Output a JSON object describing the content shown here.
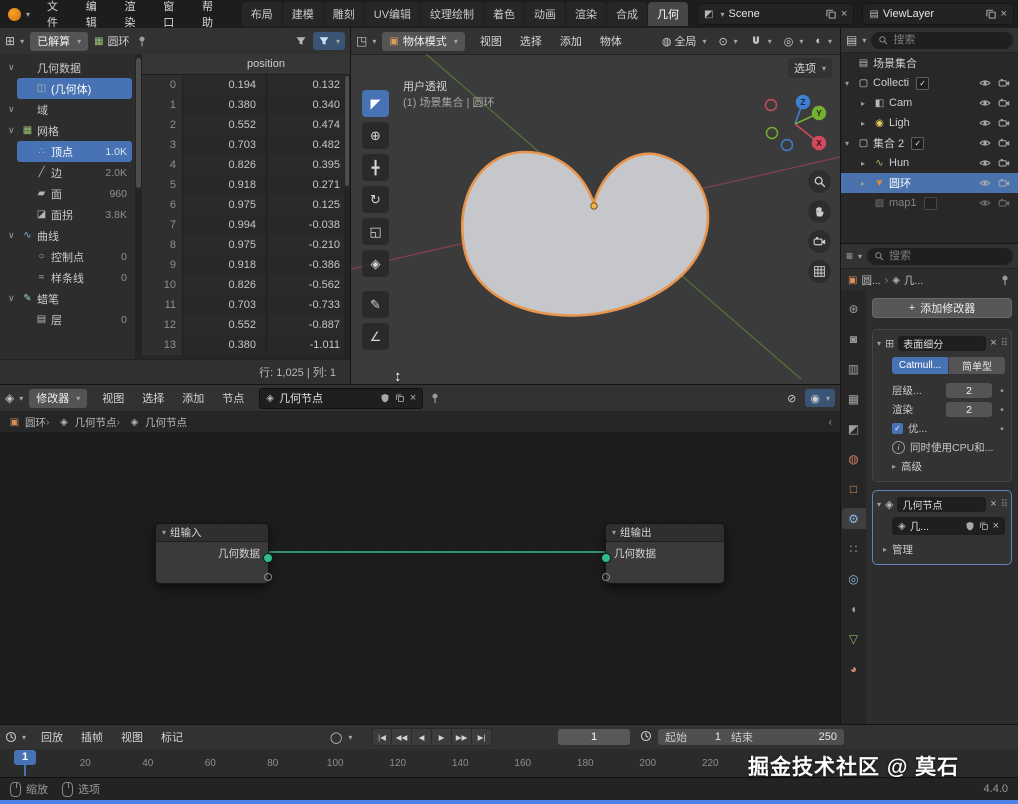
{
  "app": {
    "version": "4.4.0",
    "watermark": "掘金技术社区 @ 莫石"
  },
  "colors": {
    "accent": "#4772b3",
    "selection": "#4a72ad",
    "socket_green": "#2fbc8f",
    "curve_outline": "#e8964f",
    "axis_x": "#9c4352",
    "axis_y": "#5c8637",
    "axis_z": "#3f7fd2"
  },
  "icons": {
    "dropdown": "▾",
    "chevron_right": "▸",
    "chevron_down": "∨",
    "close": "×",
    "drag_dots": "⠿",
    "plus": "+",
    "info": "i",
    "back_arrow": "‹",
    "resize_vertical": "↕",
    "checkmark": "✓"
  },
  "topbar": {
    "menus": [
      "文件",
      "编辑",
      "渲染",
      "窗口",
      "帮助"
    ],
    "workspaces": [
      {
        "label": "布局"
      },
      {
        "label": "建模"
      },
      {
        "label": "雕刻"
      },
      {
        "label": "UV编辑"
      },
      {
        "label": "纹理绘制"
      },
      {
        "label": "着色"
      },
      {
        "label": "动画"
      },
      {
        "label": "渲染"
      },
      {
        "label": "合成"
      },
      {
        "label": "几何",
        "active": true
      }
    ],
    "scene": "Scene",
    "view_layer": "ViewLayer"
  },
  "spreadsheet": {
    "mode": "已解算",
    "object": "圆环",
    "tree": [
      {
        "label": "几何数据",
        "kind": "section"
      },
      {
        "label": "(几何体)",
        "kind": "item",
        "icon": "geometry",
        "selected": true
      },
      {
        "label": "域",
        "kind": "section"
      },
      {
        "label": "网格",
        "kind": "section",
        "icon": "mesh"
      },
      {
        "label": "顶点",
        "kind": "item",
        "icon": "vertex",
        "count": "1.0K",
        "selected": true
      },
      {
        "label": "边",
        "kind": "item",
        "icon": "edge",
        "count": "2.0K"
      },
      {
        "label": "面",
        "kind": "item",
        "icon": "face",
        "count": "960"
      },
      {
        "label": "面拐",
        "kind": "item",
        "icon": "corner",
        "count": "3.8K"
      },
      {
        "label": "曲线",
        "kind": "section",
        "icon": "curve"
      },
      {
        "label": "控制点",
        "kind": "item",
        "icon": "point",
        "count": "0"
      },
      {
        "label": "样条线",
        "kind": "item",
        "icon": "spline",
        "count": "0"
      },
      {
        "label": "蜡笔",
        "kind": "section",
        "icon": "pencil"
      },
      {
        "label": "层",
        "kind": "item",
        "icon": "layer",
        "count": "0"
      }
    ],
    "column": "position",
    "rows": [
      {
        "i": "0",
        "x": "0.194",
        "y": "0.132"
      },
      {
        "i": "1",
        "x": "0.380",
        "y": "0.340"
      },
      {
        "i": "2",
        "x": "0.552",
        "y": "0.474"
      },
      {
        "i": "3",
        "x": "0.703",
        "y": "0.482"
      },
      {
        "i": "4",
        "x": "0.826",
        "y": "0.395"
      },
      {
        "i": "5",
        "x": "0.918",
        "y": "0.271"
      },
      {
        "i": "6",
        "x": "0.975",
        "y": "0.125"
      },
      {
        "i": "7",
        "x": "0.994",
        "y": "-0.038"
      },
      {
        "i": "8",
        "x": "0.975",
        "y": "-0.210"
      },
      {
        "i": "9",
        "x": "0.918",
        "y": "-0.386"
      },
      {
        "i": "10",
        "x": "0.826",
        "y": "-0.562"
      },
      {
        "i": "11",
        "x": "0.703",
        "y": "-0.733"
      },
      {
        "i": "12",
        "x": "0.552",
        "y": "-0.887"
      },
      {
        "i": "13",
        "x": "0.380",
        "y": "-1.011"
      }
    ],
    "status": "行: 1,025  |  列: 1"
  },
  "viewport": {
    "mode": "物体模式",
    "menus": [
      "视图",
      "选择",
      "添加",
      "物体"
    ],
    "orientation": "全局",
    "options": "选项",
    "hud_perspective": "用户透视",
    "hud_context": "(1) 场景集合 | 圆环",
    "gizmo": {
      "z": "Z",
      "y": "Y",
      "x": "X"
    },
    "tools": [
      {
        "id": "select-box",
        "glyph": "◤",
        "active": true
      },
      {
        "id": "cursor",
        "glyph": "⊕"
      },
      {
        "id": "move",
        "glyph": "╋"
      },
      {
        "id": "rotate",
        "glyph": "↻"
      },
      {
        "id": "scale",
        "glyph": "◱"
      },
      {
        "id": "transform",
        "glyph": "◈"
      },
      {
        "id": "annotate",
        "glyph": "✎"
      },
      {
        "id": "measure",
        "glyph": "∠"
      }
    ]
  },
  "node_editor": {
    "mode": "修改器",
    "menus": [
      "视图",
      "选择",
      "添加",
      "节点"
    ],
    "tree_name": "几何节点",
    "breadcrumb": [
      {
        "label": "圆环",
        "icon": "object"
      },
      {
        "label": "几何节点",
        "icon": "nodes"
      },
      {
        "label": "几何节点",
        "icon": "nodes"
      }
    ],
    "input_node": {
      "title": "组输入",
      "socket": "几何数据"
    },
    "output_node": {
      "title": "组输出",
      "socket": "几何数据"
    }
  },
  "outliner": {
    "search": "搜索",
    "rows": [
      {
        "label": "场景集合",
        "icon": "scene",
        "depth": 0,
        "chev": "n",
        "check": "none",
        "controls": false
      },
      {
        "label": "Collecti",
        "icon": "collection",
        "depth": 0,
        "chev": "d",
        "check": "checked",
        "controls": true
      },
      {
        "label": "Cam",
        "icon": "camera",
        "depth": 1,
        "chev": "r",
        "check": "none",
        "controls": true
      },
      {
        "label": "Ligh",
        "icon": "light",
        "depth": 1,
        "chev": "r",
        "check": "none",
        "controls": true
      },
      {
        "label": "集合 2",
        "icon": "collection",
        "depth": 0,
        "chev": "d",
        "check": "checked",
        "controls": true
      },
      {
        "label": "Hun",
        "icon": "surface",
        "depth": 1,
        "chev": "r",
        "check": "none",
        "controls": true
      },
      {
        "label": "圆环",
        "icon": "curves",
        "depth": 1,
        "chev": "r",
        "check": "none",
        "controls": true,
        "selected": true
      },
      {
        "label": "map1",
        "icon": "image",
        "depth": 1,
        "chev": "n",
        "check": "empty",
        "controls": true,
        "dim": true
      }
    ]
  },
  "properties": {
    "search": "搜索",
    "breadcrumb_a": "圆...",
    "breadcrumb_b": "几...",
    "tabs": [
      {
        "id": "tool"
      },
      {
        "id": "render"
      },
      {
        "id": "output"
      },
      {
        "id": "viewlayer"
      },
      {
        "id": "scene"
      },
      {
        "id": "world"
      },
      {
        "id": "object"
      },
      {
        "id": "modifiers",
        "active": true
      },
      {
        "id": "particles"
      },
      {
        "id": "physics"
      },
      {
        "id": "constraints"
      },
      {
        "id": "data"
      },
      {
        "id": "material"
      }
    ],
    "add_modifier": "添加修改器",
    "subsurf": {
      "name": "表面细分",
      "catmull": "Catmull...",
      "simple": "简单型",
      "levels_label": "层级...",
      "levels": "2",
      "render_label": "渲染",
      "render": "2",
      "optimal": "优...",
      "info": "同时使用CPU和...",
      "advanced": "高级"
    },
    "geonodes": {
      "name": "几何节点",
      "tree": "几...",
      "manage": "管理"
    }
  },
  "timeline": {
    "menus": [
      "回放",
      "插帧",
      "视图",
      "标记"
    ],
    "transport": [
      "|◀",
      "◀◀",
      "◀",
      "▶",
      "▶▶",
      "▶|"
    ],
    "frame": "1",
    "start_label": "起始",
    "start": "1",
    "end_label": "结束",
    "end": "250",
    "current": "1",
    "ruler": [
      {
        "f": "20"
      },
      {
        "f": "40"
      },
      {
        "f": "60"
      },
      {
        "f": "80"
      },
      {
        "f": "100"
      },
      {
        "f": "120"
      },
      {
        "f": "140"
      },
      {
        "f": "160"
      },
      {
        "f": "180"
      },
      {
        "f": "200"
      },
      {
        "f": "220"
      }
    ]
  },
  "statusbar": {
    "zoom": "缩放",
    "options": "选项",
    "version": "4.4.0"
  }
}
